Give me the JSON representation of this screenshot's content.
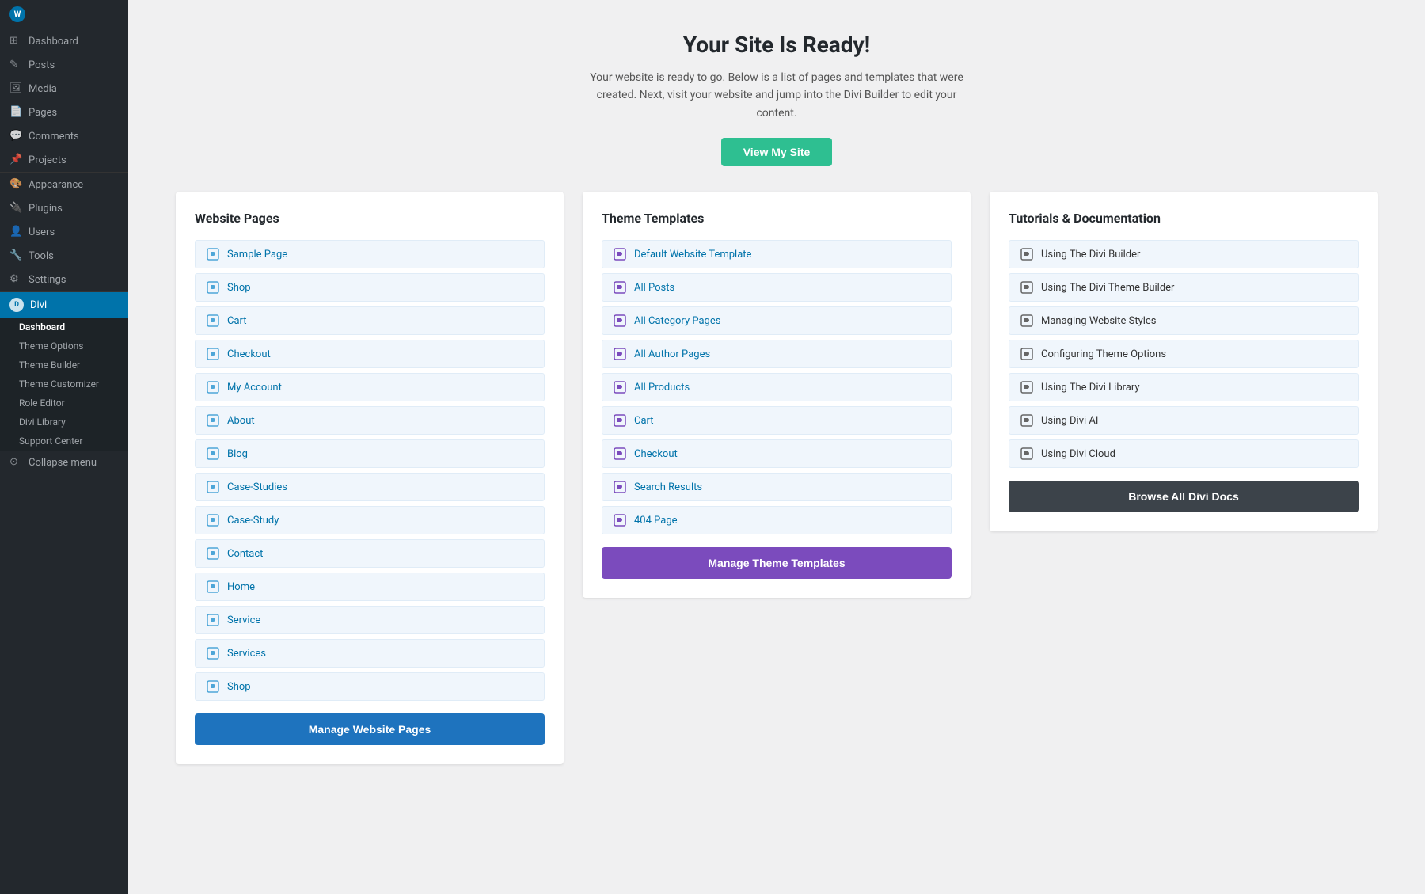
{
  "sidebar": {
    "logo_label": "WordPress",
    "items": [
      {
        "id": "dashboard",
        "label": "Dashboard",
        "icon": "⊞"
      },
      {
        "id": "posts",
        "label": "Posts",
        "icon": "✎"
      },
      {
        "id": "media",
        "label": "Media",
        "icon": "🖼"
      },
      {
        "id": "pages",
        "label": "Pages",
        "icon": "📄"
      },
      {
        "id": "comments",
        "label": "Comments",
        "icon": "💬"
      },
      {
        "id": "projects",
        "label": "Projects",
        "icon": "📌"
      },
      {
        "id": "appearance",
        "label": "Appearance",
        "icon": "🎨"
      },
      {
        "id": "plugins",
        "label": "Plugins",
        "icon": "🔌"
      },
      {
        "id": "users",
        "label": "Users",
        "icon": "👤"
      },
      {
        "id": "tools",
        "label": "Tools",
        "icon": "🔧"
      },
      {
        "id": "settings",
        "label": "Settings",
        "icon": "⚙"
      }
    ],
    "divi_label": "Divi",
    "divi_submenu": [
      {
        "id": "divi-dashboard",
        "label": "Dashboard",
        "active": true
      },
      {
        "id": "theme-options",
        "label": "Theme Options"
      },
      {
        "id": "theme-builder",
        "label": "Theme Builder"
      },
      {
        "id": "theme-customizer",
        "label": "Theme Customizer"
      },
      {
        "id": "role-editor",
        "label": "Role Editor"
      },
      {
        "id": "divi-library",
        "label": "Divi Library"
      },
      {
        "id": "support-center",
        "label": "Support Center"
      }
    ],
    "collapse_label": "Collapse menu"
  },
  "main": {
    "title": "Your Site Is Ready!",
    "subtitle": "Your website is ready to go. Below is a list of pages and templates that were created. Next, visit your website and jump into the Divi Builder to edit your content.",
    "view_site_btn": "View My Site",
    "website_pages": {
      "heading": "Website Pages",
      "items": [
        "Sample Page",
        "Shop",
        "Cart",
        "Checkout",
        "My Account",
        "About",
        "Blog",
        "Case-Studies",
        "Case-Study",
        "Contact",
        "Home",
        "Service",
        "Services",
        "Shop"
      ],
      "manage_btn": "Manage Website Pages"
    },
    "theme_templates": {
      "heading": "Theme Templates",
      "items": [
        "Default Website Template",
        "All Posts",
        "All Category Pages",
        "All Author Pages",
        "All Products",
        "Cart",
        "Checkout",
        "Search Results",
        "404 Page"
      ],
      "manage_btn": "Manage Theme Templates"
    },
    "tutorials": {
      "heading": "Tutorials & Documentation",
      "items": [
        "Using The Divi Builder",
        "Using The Divi Theme Builder",
        "Managing Website Styles",
        "Configuring Theme Options",
        "Using The Divi Library",
        "Using Divi AI",
        "Using Divi Cloud"
      ],
      "browse_btn": "Browse All Divi Docs"
    }
  }
}
